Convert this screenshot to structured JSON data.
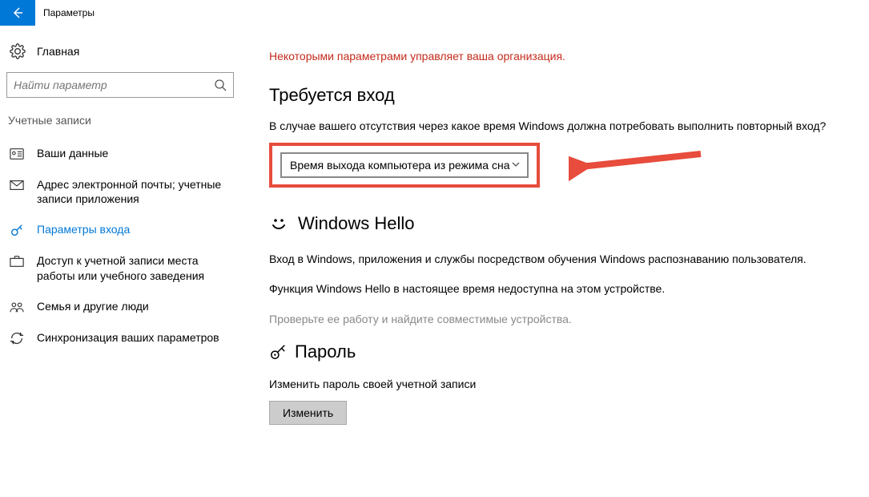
{
  "titlebar": {
    "title": "Параметры"
  },
  "sidebar": {
    "home": "Главная",
    "search_placeholder": "Найти параметр",
    "category": "Учетные записи",
    "items": [
      {
        "label": "Ваши данные"
      },
      {
        "label": "Адрес электронной почты; учетные записи приложения"
      },
      {
        "label": "Параметры входа"
      },
      {
        "label": "Доступ к учетной записи места работы или учебного заведения"
      },
      {
        "label": "Семья и другие люди"
      },
      {
        "label": "Синхронизация ваших параметров"
      }
    ]
  },
  "content": {
    "org_notice": "Некоторыми параметрами управляет ваша организация.",
    "signin_title": "Требуется вход",
    "signin_desc": "В случае вашего отсутствия через какое время Windows должна потребовать выполнить повторный вход?",
    "dropdown_value": "Время выхода компьютера из режима сна",
    "hello_title": "Windows Hello",
    "hello_desc1": "Вход в Windows, приложения и службы посредством обучения Windows распознаванию пользователя.",
    "hello_desc2": "Функция Windows Hello в настоящее время недоступна на этом устройстве.",
    "hello_check": "Проверьте ее работу и найдите совместимые устройства.",
    "password_title": "Пароль",
    "password_desc": "Изменить пароль своей учетной записи",
    "change_btn": "Изменить"
  }
}
